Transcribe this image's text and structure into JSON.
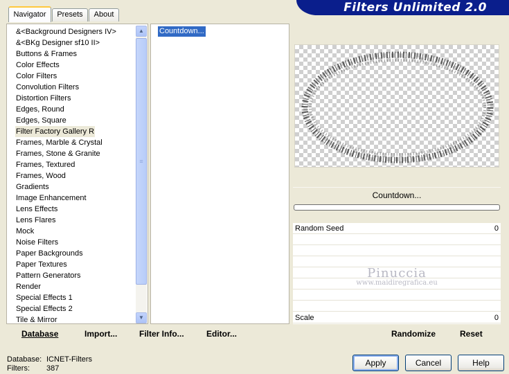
{
  "tabs": [
    {
      "label": "Navigator",
      "active": true
    },
    {
      "label": "Presets",
      "active": false
    },
    {
      "label": "About",
      "active": false
    }
  ],
  "banner": {
    "title": "Filters Unlimited 2.0"
  },
  "categories": {
    "items": [
      "&<Background Designers IV>",
      "&<BKg Designer sf10 II>",
      "Buttons & Frames",
      "Color Effects",
      "Color Filters",
      "Convolution Filters",
      "Distortion Filters",
      "Edges, Round",
      "Edges, Square",
      "Filter Factory Gallery R",
      "Frames, Marble & Crystal",
      "Frames, Stone & Granite",
      "Frames, Textured",
      "Frames, Wood",
      "Gradients",
      "Image Enhancement",
      "Lens Effects",
      "Lens Flares",
      "Mock",
      "Noise Filters",
      "Paper Backgrounds",
      "Paper Textures",
      "Pattern Generators",
      "Render",
      "Special Effects 1",
      "Special Effects 2",
      "Tile & Mirror"
    ],
    "selected": "Filter Factory Gallery R"
  },
  "filters": {
    "items": [
      "Countdown..."
    ],
    "selected": "Countdown..."
  },
  "preview": {
    "filter_name": "Countdown...",
    "progress": 0
  },
  "params": [
    {
      "label": "Random Seed",
      "value": "0"
    },
    {
      "label": "",
      "value": ""
    },
    {
      "label": "",
      "value": ""
    },
    {
      "label": "",
      "value": ""
    },
    {
      "label": "",
      "value": ""
    },
    {
      "label": "",
      "value": ""
    },
    {
      "label": "",
      "value": ""
    },
    {
      "label": "",
      "value": ""
    },
    {
      "label": "Scale",
      "value": "0"
    }
  ],
  "watermark": {
    "line1": "Pinuccia",
    "line2": "www.maidiregrafica.eu"
  },
  "links": {
    "database": "Database",
    "import": "Import...",
    "filter_info": "Filter Info...",
    "editor": "Editor...",
    "randomize": "Randomize",
    "reset": "Reset"
  },
  "status": {
    "database_label": "Database:",
    "database_value": "ICNET-Filters",
    "filters_label": "Filters:",
    "filters_value": "387"
  },
  "buttons": {
    "apply": "Apply",
    "cancel": "Cancel",
    "help": "Help"
  },
  "icons": {
    "scroll_up": "chevron-up-icon",
    "scroll_down": "chevron-down-icon",
    "grip": "scroll-grip-icon"
  }
}
